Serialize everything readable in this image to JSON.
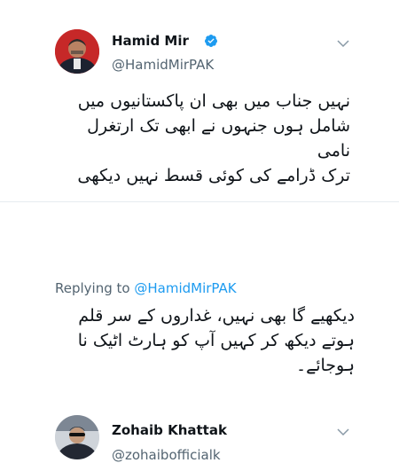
{
  "tweet1": {
    "name": "Hamid Mir",
    "handle": "@HamidMirPAK",
    "avatar_icon": "profile-photo",
    "verified_icon": "verified-badge-icon",
    "menu_icon": "chevron-down-icon",
    "text_lines": [
      "نہیں جناب میں بھی ان پاکستانیوں میں",
      "شامل ہوں جنہوں نے ابھی تک ارتغرل نامی",
      "ترک ڈرامے کی کوئی قسط نہیں دیکھی"
    ]
  },
  "tweet2": {
    "name": "Zohaib Khattak",
    "handle": "@zohaibofficialk",
    "avatar_icon": "profile-photo",
    "menu_icon": "chevron-down-icon",
    "replying_prefix": "Replying to",
    "replying_mention": "@HamidMirPAK",
    "text_lines": [
      "دیکھیے گا بھی نہیں، غداروں کے سر قلم",
      "ہوتے دیکھ کر کہیں آپ کو ہارٹ اٹیک نا",
      "ہوجائے۔"
    ]
  },
  "colors": {
    "text": "#0f1419",
    "secondary": "#536471",
    "accent": "#1d9bf0",
    "divider": "#e6ecf0"
  }
}
